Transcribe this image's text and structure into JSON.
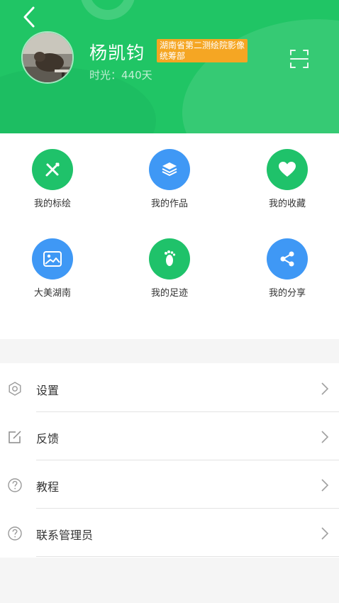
{
  "header": {
    "user_name": "杨凯钧",
    "org_badge": "湖南省第二测绘院影像统筹部",
    "time_label": "时光：",
    "time_value": "440天",
    "colors": {
      "header_bg": "#20c565",
      "badge_bg": "#f5a623"
    },
    "icons": {
      "back": "chevron-left-icon",
      "scan": "scan-icon"
    }
  },
  "grid": {
    "items": [
      {
        "label": "我的标绘",
        "icon": "pencil-ruler-icon",
        "color": "#1fc26a"
      },
      {
        "label": "我的作品",
        "icon": "stack-icon",
        "color": "#3f98f5"
      },
      {
        "label": "我的收藏",
        "icon": "heart-icon",
        "color": "#1fc26a"
      },
      {
        "label": "大美湖南",
        "icon": "landscape-image-icon",
        "color": "#3f98f5"
      },
      {
        "label": "我的足迹",
        "icon": "footprint-icon",
        "color": "#1fc26a"
      },
      {
        "label": "我的分享",
        "icon": "share-icon",
        "color": "#3f98f5"
      }
    ]
  },
  "menu": {
    "items": [
      {
        "label": "设置",
        "icon": "gear-icon"
      },
      {
        "label": "反馈",
        "icon": "edit-icon"
      },
      {
        "label": "教程",
        "icon": "help-icon"
      },
      {
        "label": "联系管理员",
        "icon": "help-icon"
      }
    ],
    "arrow_icon": "chevron-right-icon"
  }
}
